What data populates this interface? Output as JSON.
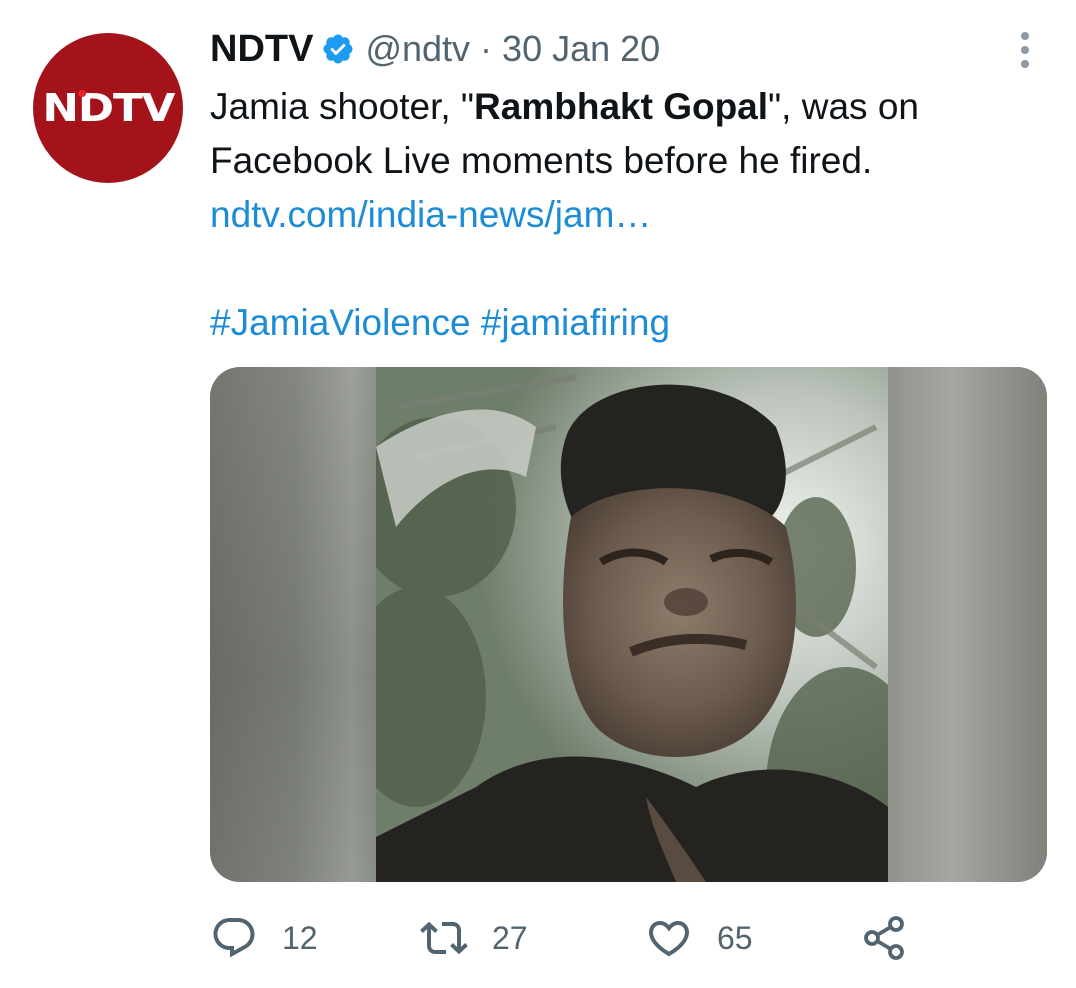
{
  "author": {
    "name": "NDTV",
    "handle": "@ndtv",
    "separator": "·",
    "date": "30 Jan 20",
    "avatar_text": "NDTV",
    "verified": true
  },
  "tweet": {
    "text_before_bold": "Jamia shooter, \"",
    "text_bold": "Rambhakt Gopal",
    "text_after_bold": "\", was on Facebook Live moments before he fired.",
    "link": "ndtv.com/india-news/jam…",
    "hashtags": [
      "#JamiaViolence",
      "#jamiafiring"
    ]
  },
  "media": {
    "type": "video-thumbnail"
  },
  "actions": {
    "reply": {
      "icon": "reply-icon",
      "count": "12"
    },
    "retweet": {
      "icon": "retweet-icon",
      "count": "27"
    },
    "like": {
      "icon": "heart-icon",
      "count": "65"
    },
    "share": {
      "icon": "share-icon"
    }
  },
  "colors": {
    "link": "#1d8cd6",
    "verified": "#1d9bf0",
    "secondary_text": "#536471",
    "avatar_bg": "#a5131a"
  }
}
